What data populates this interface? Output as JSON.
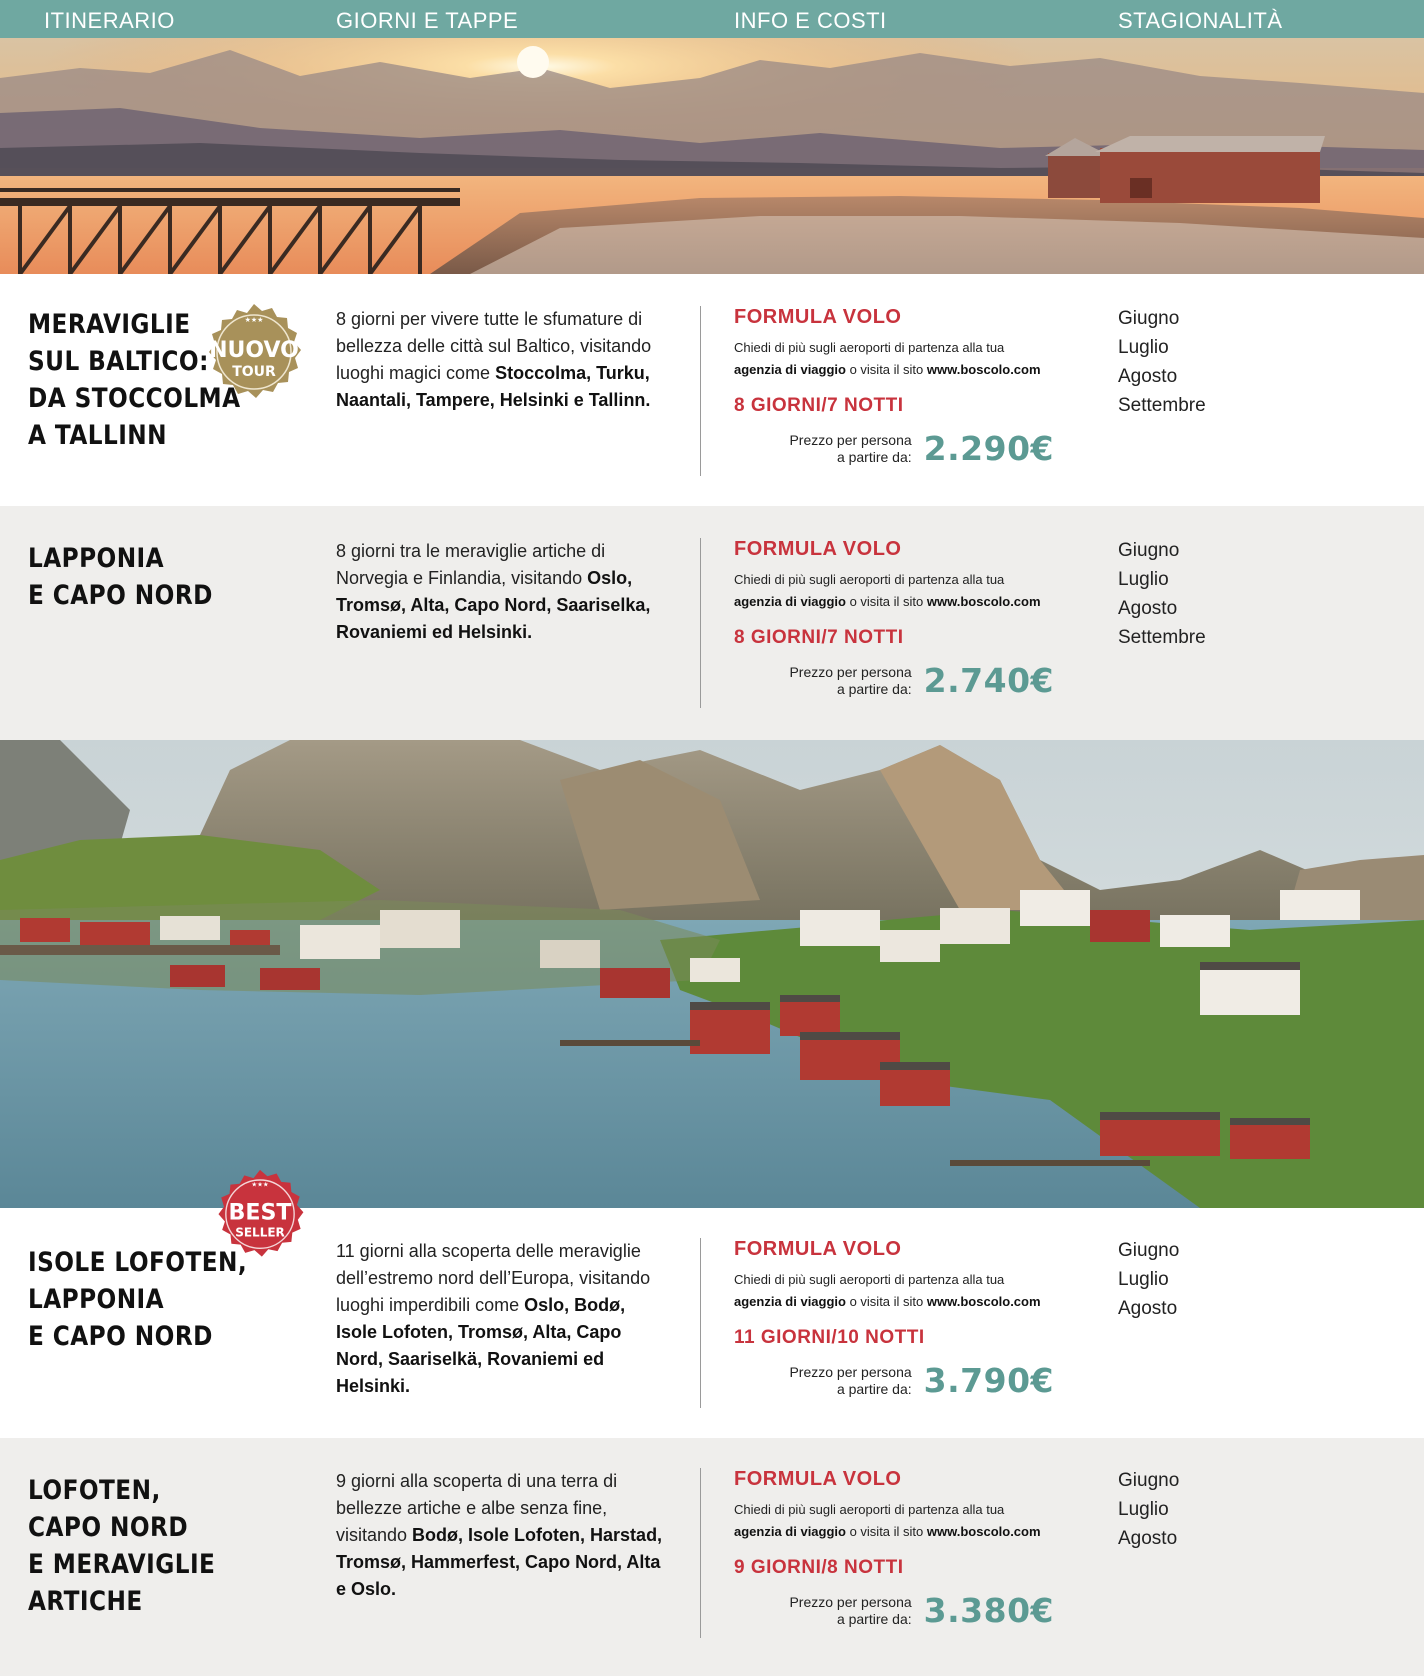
{
  "header": {
    "col1": "ITINERARIO",
    "col2": "GIORNI E TAPPE",
    "col3": "INFO E COSTI",
    "col4": "STAGIONALITÀ"
  },
  "images": {
    "banner1": "sunset-fjord-pier-photo",
    "banner2": "lofoten-fishing-village-photo"
  },
  "badges": {
    "new_tour": {
      "line1": "NUOVO",
      "line2": "TOUR",
      "color": "#a8915a"
    },
    "best_seller": {
      "line1": "BEST",
      "line2": "SELLER",
      "color": "#c8333d"
    }
  },
  "colors": {
    "header": "#6fa8a1",
    "accent_red": "#c8333d",
    "price_teal": "#5c9a93",
    "row_gray": "#efeeec"
  },
  "tours": [
    {
      "title": [
        "MERAVIGLIE",
        "SUL BALTICO:",
        "DA STOCCOLMA",
        "A TALLINN"
      ],
      "desc_intro": "8 giorni per vivere tutte le sfumature di bellezza delle città sul Baltico, visitando luoghi magici come ",
      "desc_places": "Stoccolma, Turku, Naantali, Tampere, Helsinki e Tallinn.",
      "formula": "FORMULA VOLO",
      "airports_text": "Chiedi di più sugli aeroporti di partenza alla tua",
      "agency": "agenzia di viaggio",
      "visit_text": " o visita il sito ",
      "site": "www.boscolo.com",
      "duration": "8 GIORNI/7 NOTTI",
      "price_label_1": "Prezzo per persona",
      "price_label_2": "a partire da:",
      "price": "2.290€",
      "months": [
        "Giugno",
        "Luglio",
        "Agosto",
        "Settembre"
      ]
    },
    {
      "title": [
        "LAPPONIA",
        "E CAPO NORD"
      ],
      "desc_intro": "8 giorni tra le meraviglie artiche di Norvegia e Finlandia, visitando ",
      "desc_places": "Oslo, Tromsø, Alta, Capo Nord, Saariselka, Rovaniemi ed Helsinki.",
      "formula": "FORMULA VOLO",
      "airports_text": "Chiedi di più sugli aeroporti di partenza alla tua",
      "agency": "agenzia di viaggio",
      "visit_text": " o visita il sito ",
      "site": "www.boscolo.com",
      "duration": "8 GIORNI/7 NOTTI",
      "price_label_1": "Prezzo per persona",
      "price_label_2": "a partire da:",
      "price": "2.740€",
      "months": [
        "Giugno",
        "Luglio",
        "Agosto",
        "Settembre"
      ]
    },
    {
      "title": [
        "ISOLE LOFOTEN,",
        "LAPPONIA",
        "E CAPO NORD"
      ],
      "desc_intro": "11 giorni alla scoperta delle meraviglie dell’estremo nord dell’Europa, visitando luoghi imperdibili come ",
      "desc_places": "Oslo, Bodø, Isole Lofoten, Tromsø, Alta, Capo Nord, Saariselkä, Rovaniemi ed Helsinki.",
      "formula": "FORMULA VOLO",
      "airports_text": "Chiedi di più sugli aeroporti di partenza alla tua",
      "agency": "agenzia di viaggio",
      "visit_text": " o visita il sito ",
      "site": "www.boscolo.com",
      "duration": "11 GIORNI/10 NOTTI",
      "price_label_1": "Prezzo per persona",
      "price_label_2": "a partire da:",
      "price": "3.790€",
      "months": [
        "Giugno",
        "Luglio",
        "Agosto"
      ]
    },
    {
      "title": [
        "LOFOTEN,",
        "CAPO NORD",
        "E MERAVIGLIE",
        "ARTICHE"
      ],
      "desc_intro": "9 giorni alla scoperta di una terra di bellezze artiche e albe senza fine, visitando ",
      "desc_places": "Bodø, Isole Lofoten, Harstad, Tromsø, Hammerfest, Capo Nord, Alta e Oslo.",
      "formula": "FORMULA VOLO",
      "airports_text": "Chiedi di più sugli aeroporti di partenza alla tua",
      "agency": "agenzia di viaggio",
      "visit_text": " o visita il sito ",
      "site": "www.boscolo.com",
      "duration": "9 GIORNI/8 NOTTI",
      "price_label_1": "Prezzo per persona",
      "price_label_2": "a partire da:",
      "price": "3.380€",
      "months": [
        "Giugno",
        "Luglio",
        "Agosto"
      ]
    }
  ]
}
